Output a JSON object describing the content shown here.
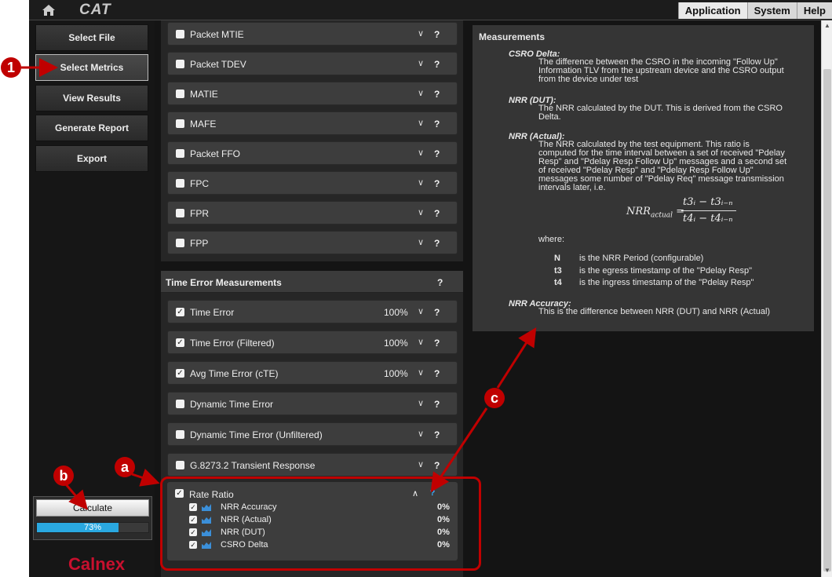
{
  "topbar": {
    "logo": "CAT",
    "tabs": [
      "Application",
      "System",
      "Help"
    ]
  },
  "sidebar": {
    "items": [
      {
        "label": "Select File"
      },
      {
        "label": "Select Metrics"
      },
      {
        "label": "View Results"
      },
      {
        "label": "Generate Report"
      },
      {
        "label": "Export"
      }
    ],
    "calculate_label": "Calculate",
    "progress_text": "73%",
    "progress_value": 0.73,
    "brand": "Calnex"
  },
  "packet_metrics": [
    {
      "label": "Packet MTIE",
      "checked": false
    },
    {
      "label": "Packet TDEV",
      "checked": false
    },
    {
      "label": "MATIE",
      "checked": false
    },
    {
      "label": "MAFE",
      "checked": false
    },
    {
      "label": "Packet FFO",
      "checked": false
    },
    {
      "label": "FPC",
      "checked": false
    },
    {
      "label": "FPR",
      "checked": false
    },
    {
      "label": "FPP",
      "checked": false
    }
  ],
  "time_error": {
    "title": "Time Error Measurements",
    "help": "?",
    "metrics": [
      {
        "label": "Time Error",
        "pct": "100%",
        "checked": true
      },
      {
        "label": "Time Error (Filtered)",
        "pct": "100%",
        "checked": true
      },
      {
        "label": "Avg Time Error (cTE)",
        "pct": "100%",
        "checked": true
      },
      {
        "label": "Dynamic Time Error",
        "pct": "",
        "checked": false
      },
      {
        "label": "Dynamic Time Error (Unfiltered)",
        "pct": "",
        "checked": false
      },
      {
        "label": "G.8273.2 Transient Response",
        "pct": "",
        "checked": false
      }
    ]
  },
  "rate_ratio": {
    "label": "Rate Ratio",
    "help": "?",
    "sub": [
      {
        "label": "NRR Accuracy",
        "pct": "0%"
      },
      {
        "label": "NRR (Actual)",
        "pct": "0%"
      },
      {
        "label": "NRR (DUT)",
        "pct": "0%"
      },
      {
        "label": "CSRO Delta",
        "pct": "0%"
      }
    ]
  },
  "description": {
    "title": "Measurements",
    "csro_term": "CSRO Delta:",
    "csro_def": "The difference between the CSRO in the incoming \"Follow Up\" Information TLV from the upstream device and the CSRO output from the device under test",
    "nrr_dut_term": "NRR (DUT):",
    "nrr_dut_def": "The NRR calculated by the DUT. This is derived from the CSRO Delta.",
    "nrr_actual_term": "NRR (Actual):",
    "nrr_actual_def": "The NRR calculated by the test equipment. This ratio is computed for the time interval between a set of received \"Pdelay Resp\" and \"Pdelay Resp Follow Up\" messages and a second set of received \"Pdelay Resp\" and \"Pdelay Resp Follow Up\" messages some number of \"Pdelay Req\" message transmission intervals later, i.e.",
    "formula_lhs": "NRR",
    "formula_lhs_sub": "actual",
    "formula_num": "t3ᵢ − t3ᵢ₋ₙ",
    "formula_den": "t4ᵢ − t4ᵢ₋ₙ",
    "where": "where:",
    "where_rows": [
      {
        "sym": "N",
        "txt": "is the NRR Period (configurable)"
      },
      {
        "sym": "t3",
        "txt": "is the egress timestamp of the \"Pdelay Resp\""
      },
      {
        "sym": "t4",
        "txt": "is the ingress timestamp of the \"Pdelay Resp\""
      }
    ],
    "accuracy_term": "NRR Accuracy:",
    "accuracy_def": "This is the difference between NRR (DUT) and NRR (Actual)"
  },
  "annotations": {
    "one": "1",
    "a": "a",
    "b": "b",
    "c": "c"
  },
  "colors": {
    "annotation": "#c00000",
    "progress": "#2aa8e0",
    "help_link": "#3bb0ff",
    "brand": "#c8102e"
  }
}
